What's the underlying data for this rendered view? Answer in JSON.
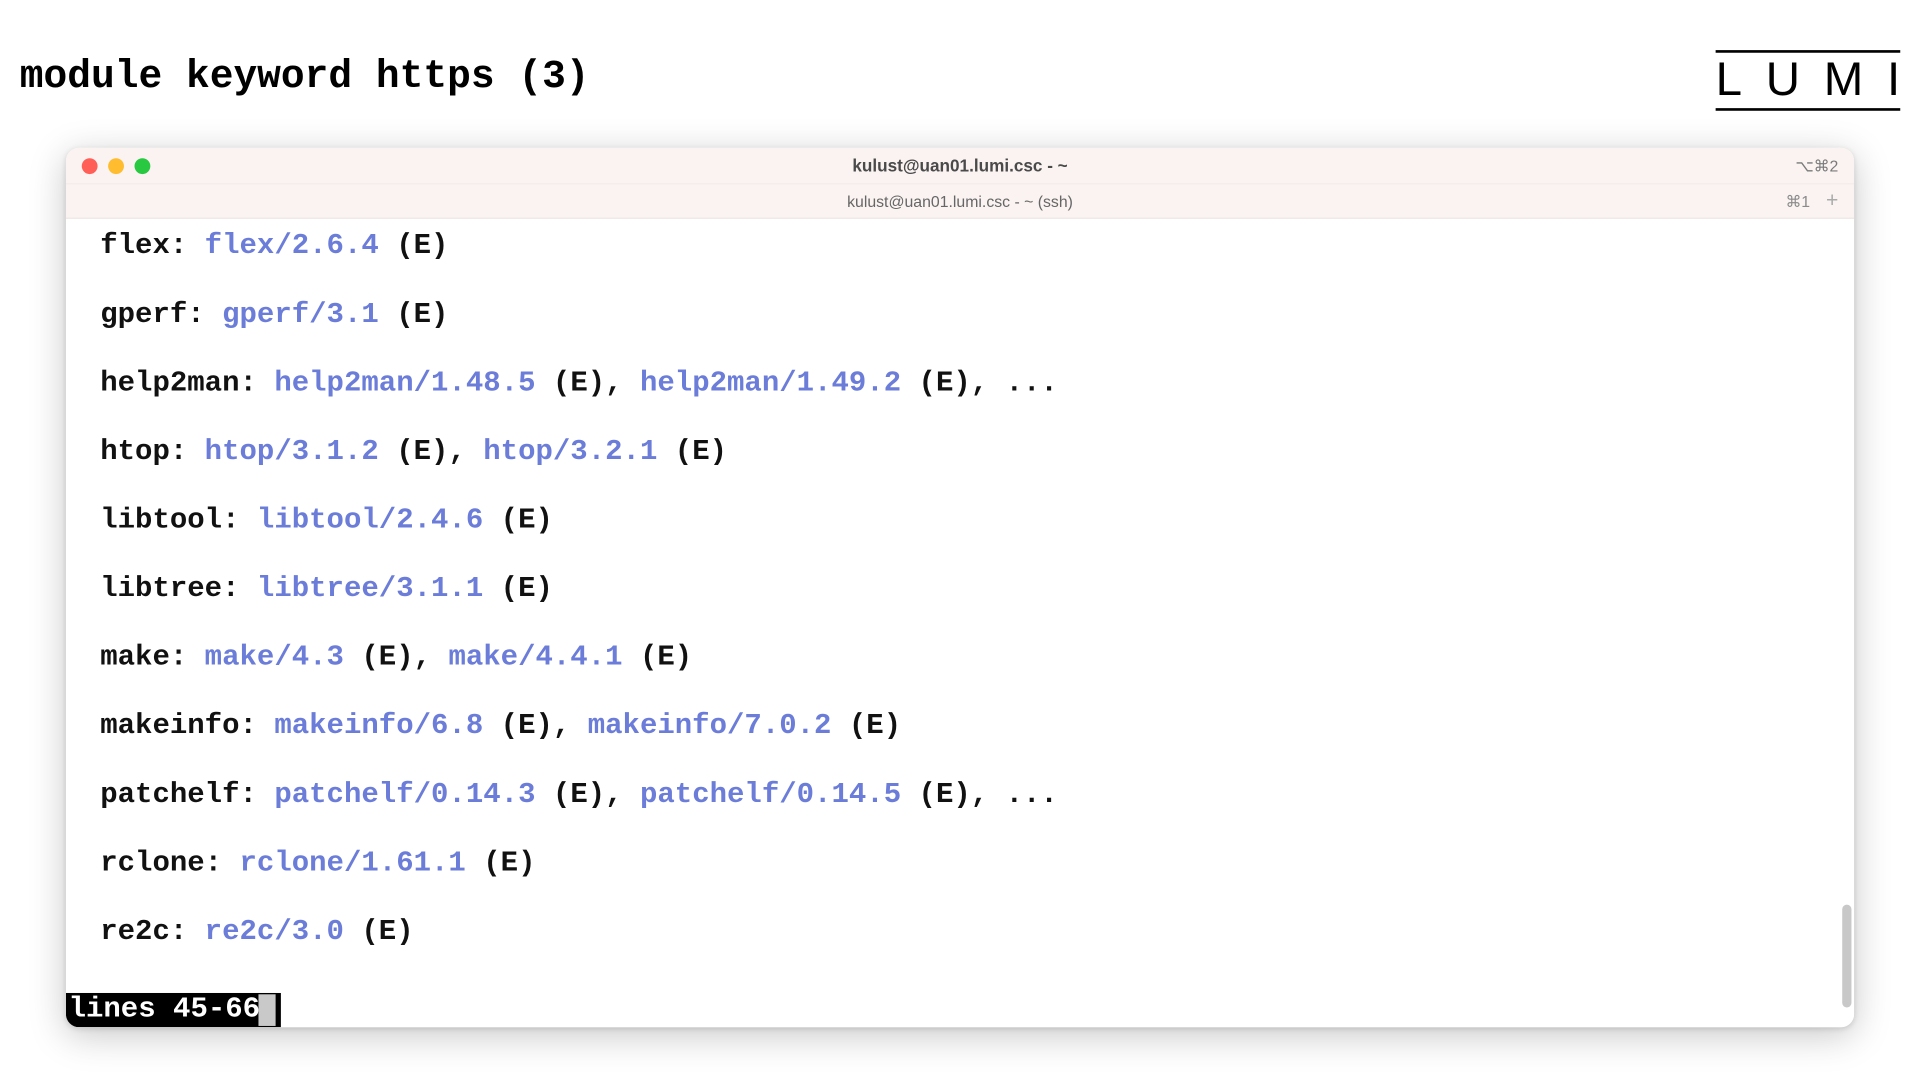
{
  "slide": {
    "title": "module keyword https (3)",
    "logo": "LUMI"
  },
  "window": {
    "title": "kulust@uan01.lumi.csc - ~",
    "titlebar_hint": "⌥⌘2",
    "tab_title": "kulust@uan01.lumi.csc - ~ (ssh)",
    "tab_hint": "⌘1"
  },
  "terminal": {
    "entries": [
      {
        "key": "flex",
        "mods": [
          {
            "m": "flex/2.6.4",
            "e": true
          }
        ],
        "trailing": false
      },
      {
        "key": "gperf",
        "mods": [
          {
            "m": "gperf/3.1",
            "e": true
          }
        ],
        "trailing": false
      },
      {
        "key": "help2man",
        "mods": [
          {
            "m": "help2man/1.48.5",
            "e": true
          },
          {
            "m": "help2man/1.49.2",
            "e": true
          }
        ],
        "trailing": true
      },
      {
        "key": "htop",
        "mods": [
          {
            "m": "htop/3.1.2",
            "e": true
          },
          {
            "m": "htop/3.2.1",
            "e": true
          }
        ],
        "trailing": false
      },
      {
        "key": "libtool",
        "mods": [
          {
            "m": "libtool/2.4.6",
            "e": true
          }
        ],
        "trailing": false
      },
      {
        "key": "libtree",
        "mods": [
          {
            "m": "libtree/3.1.1",
            "e": true
          }
        ],
        "trailing": false
      },
      {
        "key": "make",
        "mods": [
          {
            "m": "make/4.3",
            "e": true
          },
          {
            "m": "make/4.4.1",
            "e": true
          }
        ],
        "trailing": false
      },
      {
        "key": "makeinfo",
        "mods": [
          {
            "m": "makeinfo/6.8",
            "e": true
          },
          {
            "m": "makeinfo/7.0.2",
            "e": true
          }
        ],
        "trailing": false
      },
      {
        "key": "patchelf",
        "mods": [
          {
            "m": "patchelf/0.14.3",
            "e": true
          },
          {
            "m": "patchelf/0.14.5",
            "e": true
          }
        ],
        "trailing": true
      },
      {
        "key": "rclone",
        "mods": [
          {
            "m": "rclone/1.61.1",
            "e": true
          }
        ],
        "trailing": false
      },
      {
        "key": "re2c",
        "mods": [
          {
            "m": "re2c/3.0",
            "e": true
          }
        ],
        "trailing": false
      }
    ],
    "pager_status": "lines 45-66"
  }
}
